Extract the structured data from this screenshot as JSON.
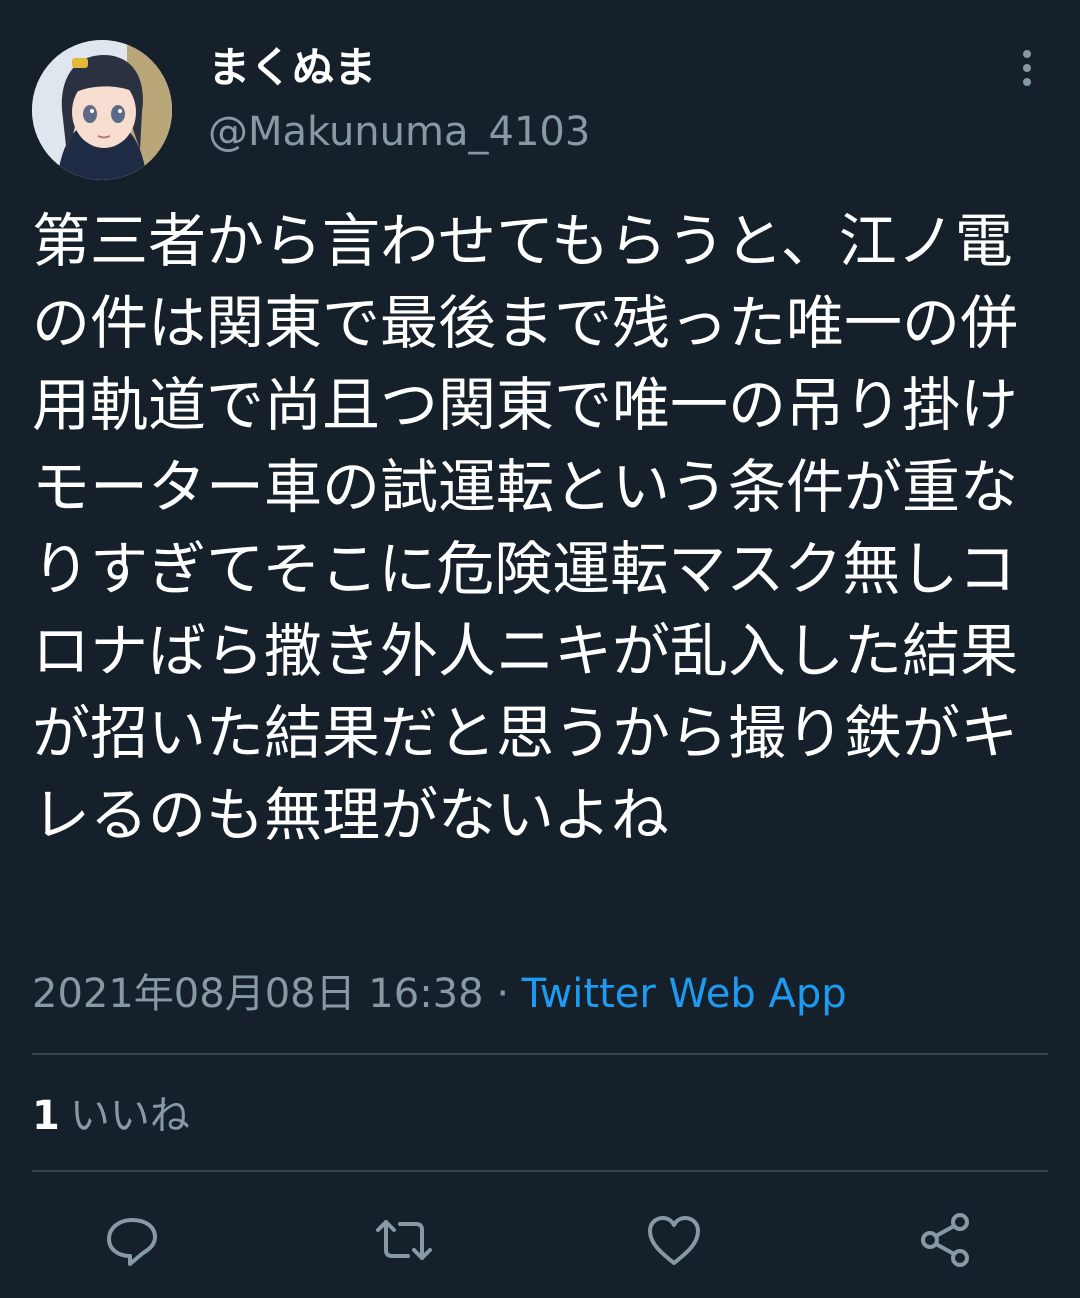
{
  "tweet": {
    "display_name": "まくぬま",
    "handle": "@Makunuma_4103",
    "text": "第三者から言わせてもらうと、江ノ電の件は関東で最後まで残った唯一の併用軌道で尚且つ関東で唯一の吊り掛けモーター車の試運転という条件が重なりすぎてそこに危険運転マスク無しコロナばら撒き外人ニキが乱入した結果が招いた結果だと思うから撮り鉄がキレるのも無理がないよね",
    "timestamp": "2021年08月08日 16:38",
    "separator": "·",
    "source": "Twitter Web App",
    "likes_count": "1",
    "likes_label": "いいね"
  },
  "icons": {
    "more": "more-vertical-icon",
    "reply": "reply-icon",
    "retweet": "retweet-icon",
    "like": "heart-icon",
    "share": "share-icon"
  },
  "colors": {
    "background": "#15202b",
    "text": "#ffffff",
    "secondary": "#8899a6",
    "link": "#1d9bf0",
    "divider": "#38444d"
  }
}
